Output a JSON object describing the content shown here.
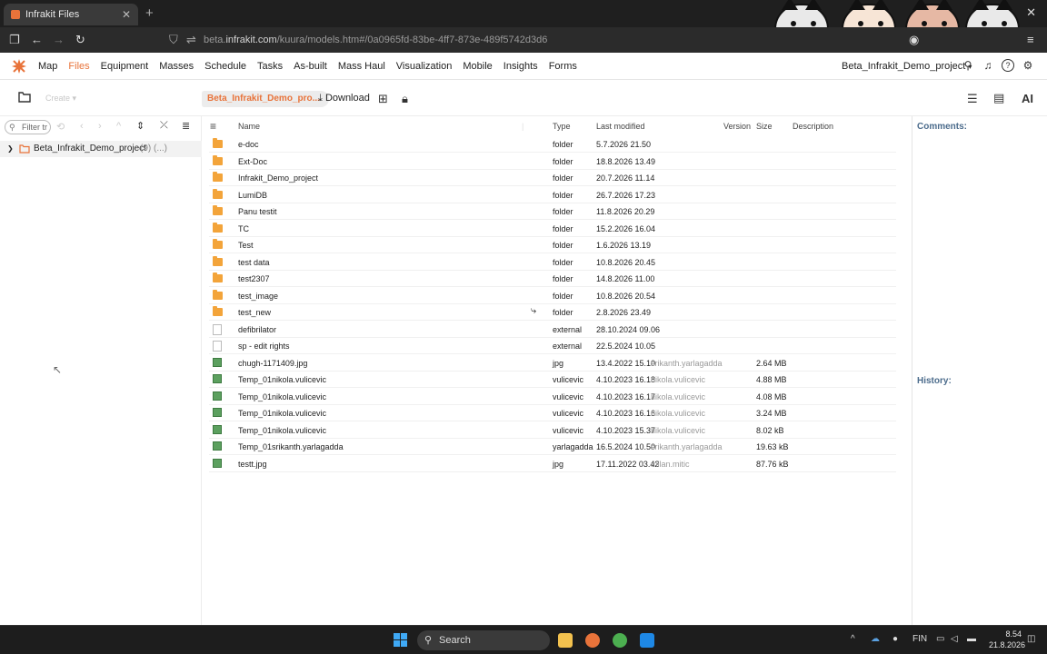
{
  "browser": {
    "tab_title": "Infrakit Files",
    "url_prefix": "beta.",
    "url_host": "infrakit.com",
    "url_path": "/kuura/models.htm#/0a0965fd-83be-4ff7-873e-489f5742d3d6"
  },
  "app": {
    "menu": [
      "Map",
      "Files",
      "Equipment",
      "Masses",
      "Schedule",
      "Tasks",
      "As-built",
      "Mass Haul",
      "Visualization",
      "Mobile",
      "Insights",
      "Forms"
    ],
    "active_menu": "Files",
    "project_select": "Beta_Infrakit_Demo_project",
    "accent": "#e8733a"
  },
  "toolbar": {
    "create_label": "Create",
    "breadcrumb": "Beta_Infrakit_Demo_pro...",
    "download_label": "Download",
    "ai_label": "AI"
  },
  "left": {
    "filter_placeholder": "Filter tr",
    "tree_root": "Beta_Infrakit_Demo_project",
    "tree_meta": "(9) (...)"
  },
  "table": {
    "headers": {
      "name": "Name",
      "type": "Type",
      "modified": "Last modified",
      "version": "Version",
      "size": "Size",
      "description": "Description"
    },
    "rows": [
      {
        "icon": "folder",
        "name": "e-doc",
        "type": "folder",
        "modified": "5.7.2026 21.50",
        "user": "",
        "size": ""
      },
      {
        "icon": "folder",
        "name": "Ext-Doc",
        "type": "folder",
        "modified": "18.8.2026 13.49",
        "user": "",
        "size": ""
      },
      {
        "icon": "folder",
        "name": "Infrakit_Demo_project",
        "type": "folder",
        "modified": "20.7.2026 11.14",
        "user": "",
        "size": ""
      },
      {
        "icon": "folder",
        "name": "LumiDB",
        "type": "folder",
        "modified": "26.7.2026 17.23",
        "user": "",
        "size": ""
      },
      {
        "icon": "folder",
        "name": "Panu testit",
        "type": "folder",
        "modified": "11.8.2026 20.29",
        "user": "",
        "size": ""
      },
      {
        "icon": "folder",
        "name": "TC",
        "type": "folder",
        "modified": "15.2.2026 16.04",
        "user": "",
        "size": ""
      },
      {
        "icon": "folder",
        "name": "Test",
        "type": "folder",
        "modified": "1.6.2026 13.19",
        "user": "",
        "size": ""
      },
      {
        "icon": "folder",
        "name": "test data",
        "type": "folder",
        "modified": "10.8.2026 20.45",
        "user": "",
        "size": ""
      },
      {
        "icon": "folder",
        "name": "test2307",
        "type": "folder",
        "modified": "14.8.2026 11.00",
        "user": "",
        "size": ""
      },
      {
        "icon": "folder",
        "name": "test_image",
        "type": "folder",
        "modified": "10.8.2026 20.54",
        "user": "",
        "size": ""
      },
      {
        "icon": "folder",
        "name": "test_new",
        "type": "folder",
        "modified": "2.8.2026 23.49",
        "user": "",
        "size": ""
      },
      {
        "icon": "file",
        "name": "defibrilator",
        "type": "external",
        "modified": "28.10.2024 09.06",
        "user": "",
        "size": ""
      },
      {
        "icon": "file",
        "name": "sp - edit rights",
        "type": "external",
        "modified": "22.5.2024 10.05",
        "user": "",
        "size": ""
      },
      {
        "icon": "image",
        "name": "chugh-1171409.jpg",
        "type": "jpg",
        "modified": "13.4.2022 15.10",
        "user": "srikanth.yarlagadda",
        "size": "2.64 MB"
      },
      {
        "icon": "image",
        "name": "Temp_01nikola.vulicevic",
        "type": "vulicevic",
        "modified": "4.10.2023 16.18",
        "user": "nikola.vulicevic",
        "size": "4.88 MB"
      },
      {
        "icon": "image",
        "name": "Temp_01nikola.vulicevic",
        "type": "vulicevic",
        "modified": "4.10.2023 16.17",
        "user": "nikola.vulicevic",
        "size": "4.08 MB"
      },
      {
        "icon": "image",
        "name": "Temp_01nikola.vulicevic",
        "type": "vulicevic",
        "modified": "4.10.2023 16.16",
        "user": "nikola.vulicevic",
        "size": "3.24 MB"
      },
      {
        "icon": "image",
        "name": "Temp_01nikola.vulicevic",
        "type": "vulicevic",
        "modified": "4.10.2023 15.37",
        "user": "nikola.vulicevic",
        "size": "8.02 kB"
      },
      {
        "icon": "image",
        "name": "Temp_01srikanth.yarlagadda",
        "type": "yarlagadda",
        "modified": "16.5.2024 10.50",
        "user": "srikanth.yarlagadda",
        "size": "19.63 kB"
      },
      {
        "icon": "image",
        "name": "testt.jpg",
        "type": "jpg",
        "modified": "17.11.2022 03.42",
        "user": "milan.mitic",
        "size": "87.76 kB"
      }
    ]
  },
  "right": {
    "comments_label": "Comments:",
    "history_label": "History:"
  },
  "taskbar": {
    "search_label": "Search",
    "lang": "FIN",
    "time": "8.54",
    "date": "21.8.2026"
  }
}
